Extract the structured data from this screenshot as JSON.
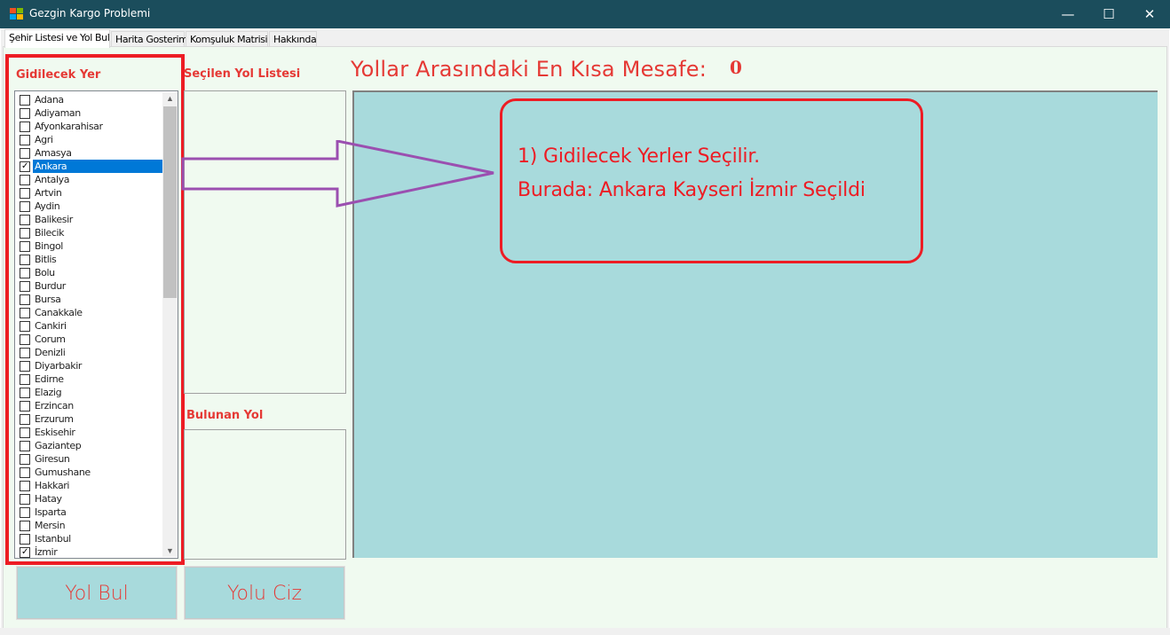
{
  "window": {
    "title": "Gezgin Kargo Problemi",
    "minimize": "—",
    "maximize": "☐",
    "close": "✕"
  },
  "tabs": [
    {
      "label": "Şehir Listesi ve Yol Bul",
      "active": true
    },
    {
      "label": "Harita Gosterimi",
      "active": false
    },
    {
      "label": "Komşuluk Matrisi",
      "active": false
    },
    {
      "label": "Hakkında",
      "active": false
    }
  ],
  "left_panel": {
    "title": "Gidilecek Yer",
    "cities": [
      {
        "name": "Adana",
        "checked": false
      },
      {
        "name": "Adiyaman",
        "checked": false
      },
      {
        "name": "Afyonkarahisar",
        "checked": false
      },
      {
        "name": "Agri",
        "checked": false
      },
      {
        "name": "Amasya",
        "checked": false
      },
      {
        "name": "Ankara",
        "checked": true,
        "selected": true
      },
      {
        "name": "Antalya",
        "checked": false
      },
      {
        "name": "Artvin",
        "checked": false
      },
      {
        "name": "Aydin",
        "checked": false
      },
      {
        "name": "Balikesir",
        "checked": false
      },
      {
        "name": "Bilecik",
        "checked": false
      },
      {
        "name": "Bingol",
        "checked": false
      },
      {
        "name": "Bitlis",
        "checked": false
      },
      {
        "name": "Bolu",
        "checked": false
      },
      {
        "name": "Burdur",
        "checked": false
      },
      {
        "name": "Bursa",
        "checked": false
      },
      {
        "name": "Canakkale",
        "checked": false
      },
      {
        "name": "Cankiri",
        "checked": false
      },
      {
        "name": "Corum",
        "checked": false
      },
      {
        "name": "Denizli",
        "checked": false
      },
      {
        "name": "Diyarbakir",
        "checked": false
      },
      {
        "name": "Edirne",
        "checked": false
      },
      {
        "name": "Elazig",
        "checked": false
      },
      {
        "name": "Erzincan",
        "checked": false
      },
      {
        "name": "Erzurum",
        "checked": false
      },
      {
        "name": "Eskisehir",
        "checked": false
      },
      {
        "name": "Gaziantep",
        "checked": false
      },
      {
        "name": "Giresun",
        "checked": false
      },
      {
        "name": "Gumushane",
        "checked": false
      },
      {
        "name": "Hakkari",
        "checked": false
      },
      {
        "name": "Hatay",
        "checked": false
      },
      {
        "name": "Isparta",
        "checked": false
      },
      {
        "name": "Mersin",
        "checked": false
      },
      {
        "name": "Istanbul",
        "checked": false
      },
      {
        "name": "İzmir",
        "checked": true
      }
    ]
  },
  "selected_roads": {
    "title": "Seçilen Yol Listesi"
  },
  "found_road": {
    "title": "Bulunan Yol"
  },
  "buttons": {
    "find": "Yol Bul",
    "draw": "Yolu Ciz"
  },
  "result": {
    "label": "Yollar Arasındaki En Kısa Mesafe:",
    "value": "0"
  },
  "annotation": {
    "line1": "1) Gidilecek Yerler Seçilir.",
    "line2": "Burada:  Ankara Kayseri İzmir Seçildi"
  },
  "colors": {
    "titlebar": "#1b4d5c",
    "accent_red": "#e53935",
    "annotation_red": "#ed1c24",
    "map_bg": "#a8dadc",
    "arrow_purple": "#9b4fb0",
    "selection_blue": "#0078d7"
  }
}
